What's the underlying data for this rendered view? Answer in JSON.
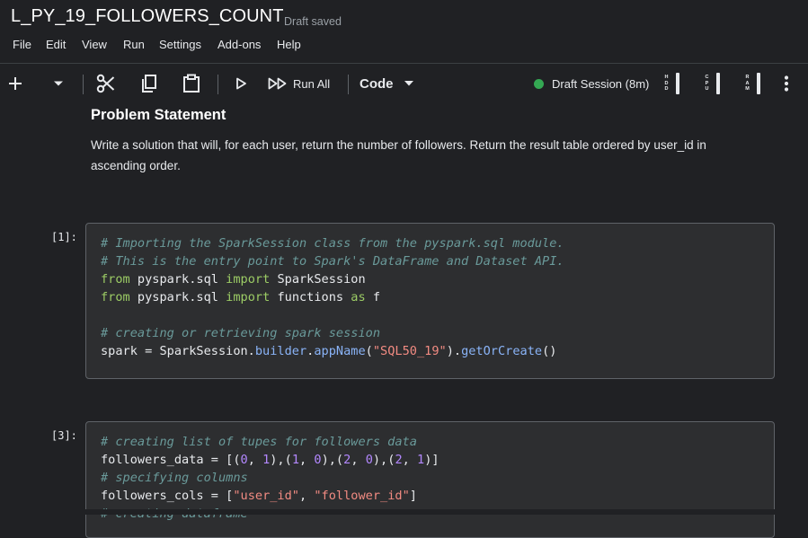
{
  "app": {
    "notebook_title": "L_PY_19_FOLLOWERS_COUNT",
    "save_status": "Draft saved"
  },
  "menu": [
    "File",
    "Edit",
    "View",
    "Run",
    "Settings",
    "Add-ons",
    "Help"
  ],
  "toolbar": {
    "run_all_label": "Run All",
    "cell_type_label": "Code",
    "session_label": "Draft Session (8m)",
    "meters": [
      {
        "label": "HDD",
        "letters": [
          "H",
          "D",
          "D"
        ]
      },
      {
        "label": "CPU",
        "letters": [
          "C",
          "P",
          "U"
        ]
      },
      {
        "label": "RAM",
        "letters": [
          "R",
          "A",
          "M"
        ]
      }
    ],
    "icons": [
      "add-icon",
      "chevron-down-icon",
      "cut-icon",
      "copy-icon",
      "paste-icon",
      "run-icon",
      "run-all-icon",
      "more-vert-icon"
    ]
  },
  "markdown_cell": {
    "heading": "Problem Statement",
    "body": "Write a solution that will, for each user, return the number of followers. Return the result table ordered by user_id in ascending order."
  },
  "code_cells": [
    {
      "exec_count": "[1]:",
      "lines": [
        "# Importing the SparkSession class from the pyspark.sql module.",
        "# This is the entry point to Spark's DataFrame and Dataset API.",
        "from pyspark.sql import SparkSession",
        "from pyspark.sql import functions as f",
        "",
        "# creating or retrieving spark session",
        "spark = SparkSession.builder.appName(\"SQL50_19\").getOrCreate()"
      ]
    },
    {
      "exec_count": "[3]:",
      "lines": [
        "# creating list of tupes for followers data",
        "followers_data = [(0, 1),(1, 0),(2, 0),(2, 1)]",
        "# specifying columns",
        "followers_cols = [\"user_id\", \"follower_id\"]",
        "# creating dataframe"
      ]
    }
  ]
}
